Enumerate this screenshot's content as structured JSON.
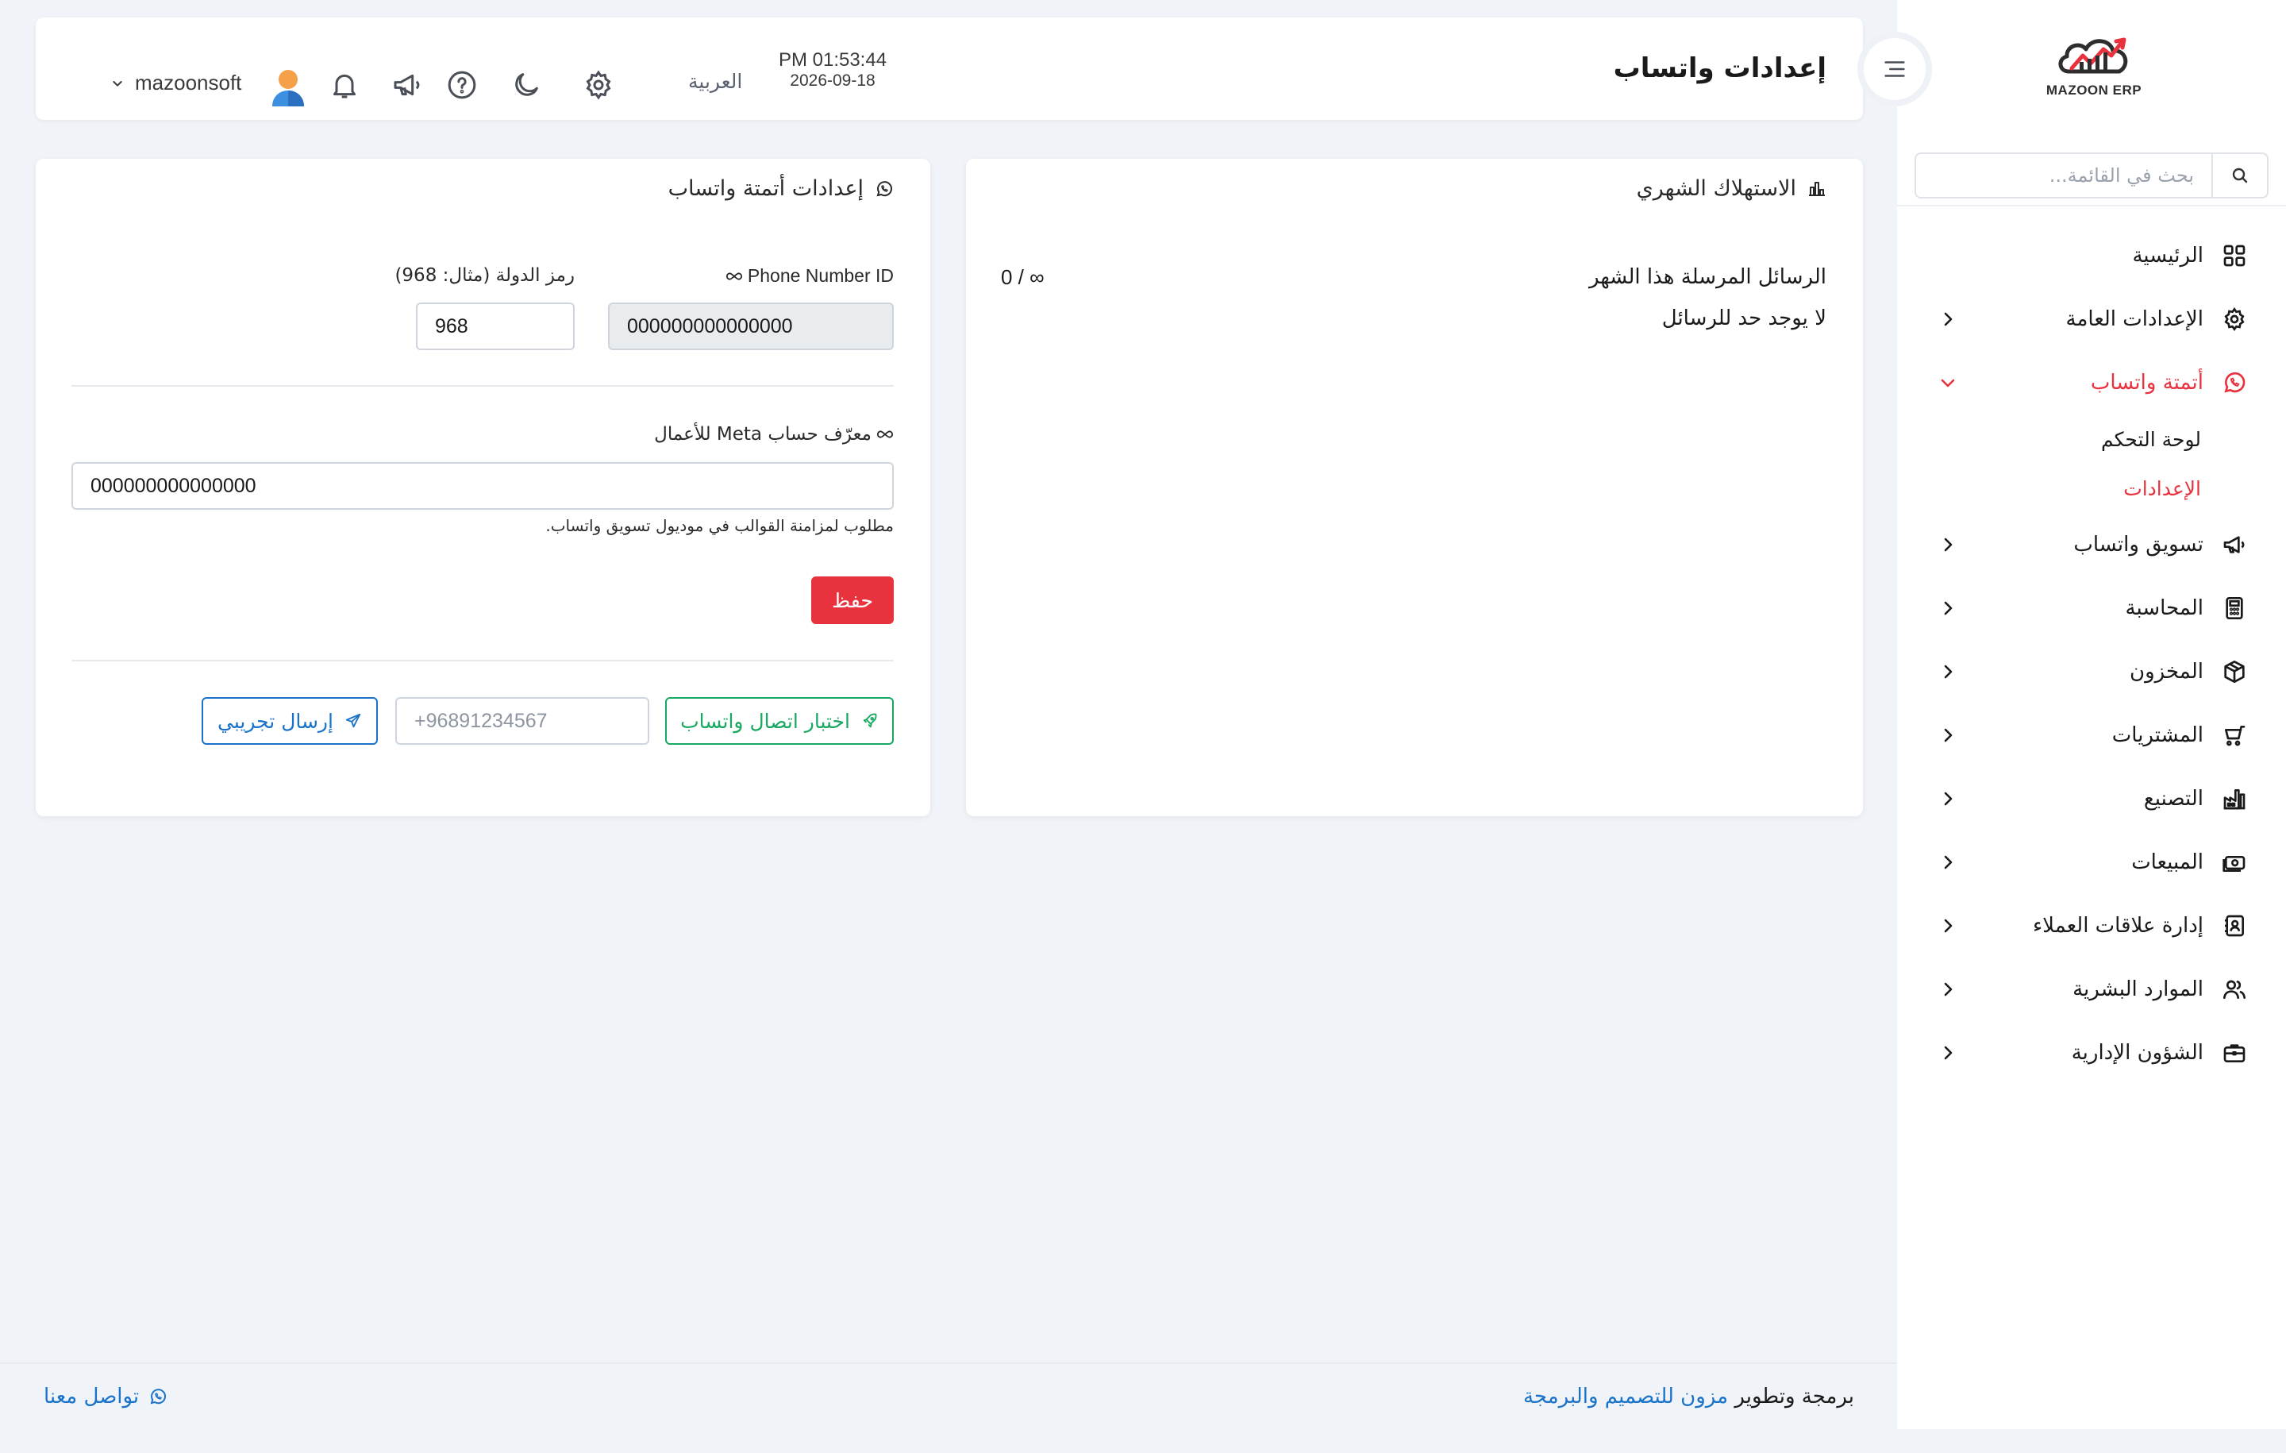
{
  "app": {
    "logo_text": "MAZOON ERP",
    "logo_small_text": "ERP"
  },
  "header": {
    "title": "إعدادات واتساب",
    "time": "PM 01:53:44",
    "date": "2026-09-18",
    "language": "العربية",
    "username": "mazoonsoft"
  },
  "sidebar": {
    "search_placeholder": "بحث في القائمة...",
    "items": [
      {
        "label": "الرئيسية",
        "icon": "grid-icon"
      },
      {
        "label": "الإعدادات العامة",
        "icon": "gear-icon"
      },
      {
        "label": "أتمتة واتساب",
        "icon": "whatsapp-icon",
        "active": true
      },
      {
        "label": "تسويق واتساب",
        "icon": "megaphone-icon"
      },
      {
        "label": "المحاسبة",
        "icon": "calculator-icon"
      },
      {
        "label": "المخزون",
        "icon": "box-icon"
      },
      {
        "label": "المشتريات",
        "icon": "cart-icon"
      },
      {
        "label": "التصنيع",
        "icon": "factory-icon"
      },
      {
        "label": "المبيعات",
        "icon": "cash-icon"
      },
      {
        "label": "إدارة علاقات العملاء",
        "icon": "contacts-icon"
      },
      {
        "label": "الموارد البشرية",
        "icon": "users-icon"
      },
      {
        "label": "الشؤون الإدارية",
        "icon": "briefcase-icon"
      }
    ],
    "subitems": [
      {
        "label": "لوحة التحكم"
      },
      {
        "label": "الإعدادات",
        "active": true
      }
    ]
  },
  "usage_card": {
    "title": "الاستهلاك الشهري",
    "messages_label": "الرسائل المرسلة هذا الشهر",
    "messages_value": "0 / ∞",
    "limit_note": "لا يوجد حد للرسائل"
  },
  "settings_card": {
    "title": "إعدادات أتمتة واتساب",
    "phone_id_label": "Phone Number ID",
    "phone_id_value": "000000000000000",
    "country_code_label": "رمز الدولة (مثال: 968)",
    "country_code_value": "968",
    "meta_label": "معرّف حساب Meta للأعمال",
    "meta_value": "000000000000000",
    "meta_help": "مطلوب لمزامنة القوالب في موديول تسويق واتساب.",
    "save_label": "حفظ",
    "test_label": "اختبار اتصال واتساب",
    "phone_placeholder": "+96891234567",
    "send_label": "إرسال تجريبي"
  },
  "footer": {
    "credit_prefix": "برمجة وتطوير",
    "credit_link": "مزون للتصميم والبرمجة",
    "contact": "تواصل معنا"
  },
  "colors": {
    "accent": "#e8333f",
    "success": "#19a861",
    "link": "#1a73c8",
    "background": "#f0f3f7"
  }
}
